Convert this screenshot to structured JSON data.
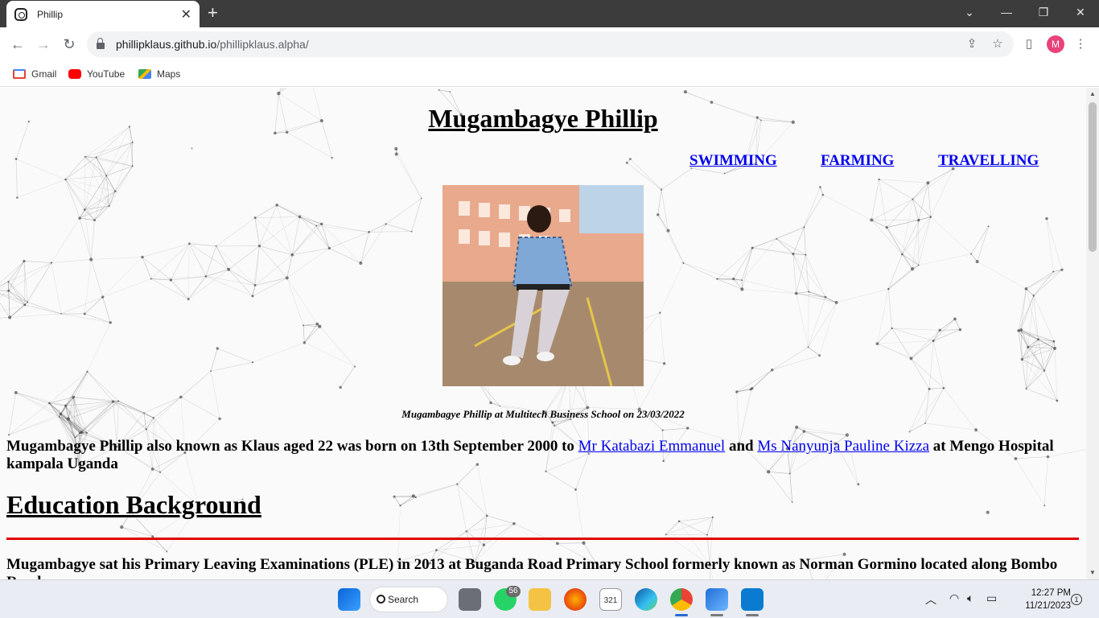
{
  "browser": {
    "tab_title": "Phillip",
    "url_host": "phillipklaus.github.io",
    "url_path": "/phillipklaus.alpha/",
    "avatar_letter": "M",
    "bookmarks": [
      {
        "label": "Gmail",
        "icon": "gmail-icon",
        "color": "#ea4335"
      },
      {
        "label": "YouTube",
        "icon": "youtube-icon",
        "color": "#ff0000"
      },
      {
        "label": "Maps",
        "icon": "maps-icon",
        "color": "#34a853"
      }
    ]
  },
  "page": {
    "title": "Mugambagye Phillip",
    "hobbies": [
      "SWIMMING",
      "FARMING",
      "TRAVELLING"
    ],
    "caption": "Mugambagye Phillip at Multitech Business School on 23/03/2022",
    "intro": {
      "before": "Mugambagye Phillip also known as Klaus aged 22 was born on 13th September 2000 to ",
      "father": "Mr Katabazi Emmanuel",
      "and": " and ",
      "mother": "Ms Nanyunja Pauline Kizza",
      "after": " at Mengo Hospital kampala Uganda"
    },
    "education_heading": "Education Background",
    "education_text": "Mugambagye sat his Primary Leaving Examinations (PLE) in 2013 at Buganda Road Primary School formerly known as Norman Gormino located along Bombo Road"
  },
  "taskbar": {
    "search_label": "Search",
    "whatsapp_badge": "56",
    "calendar_day": "321",
    "time": "12:27 PM",
    "date": "11/21/2023",
    "notification_count": "1"
  }
}
